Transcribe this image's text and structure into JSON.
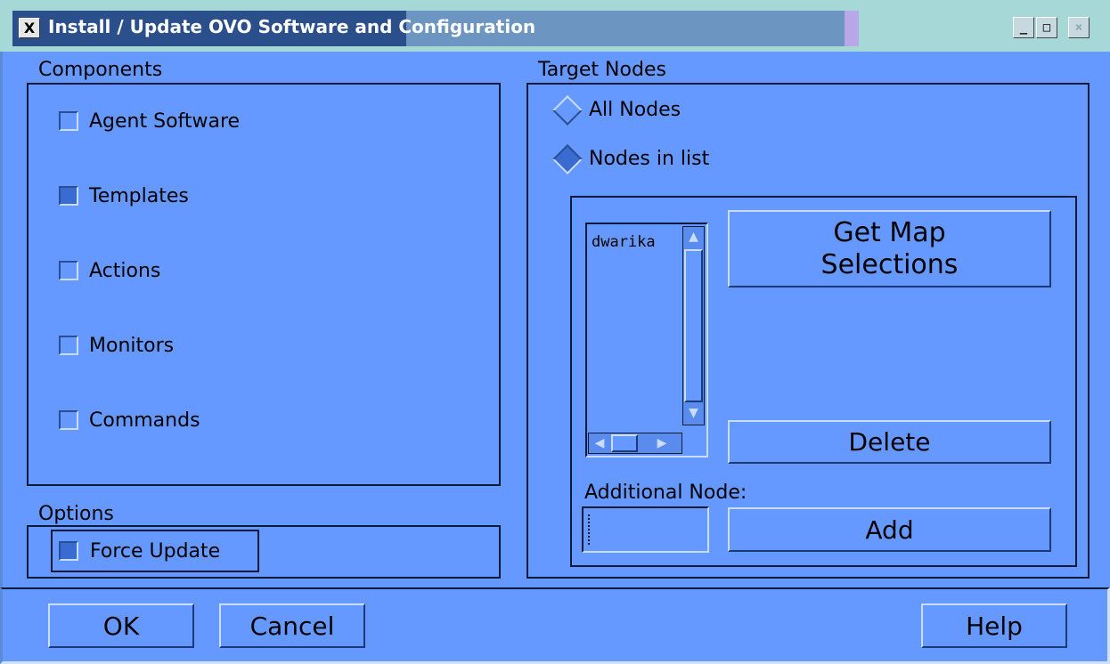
{
  "window": {
    "title": "Install / Update OVO Software and Configuration",
    "icon": "x-window-icon",
    "controls": {
      "minimize": "_",
      "maximize": "□",
      "close": "×"
    }
  },
  "components": {
    "label": "Components",
    "items": [
      {
        "label": "Agent Software",
        "checked": false
      },
      {
        "label": "Templates",
        "checked": true
      },
      {
        "label": "Actions",
        "checked": false
      },
      {
        "label": "Monitors",
        "checked": false
      },
      {
        "label": "Commands",
        "checked": false
      }
    ]
  },
  "options": {
    "label": "Options",
    "force_update": {
      "label": "Force Update",
      "checked": true
    }
  },
  "target_nodes": {
    "label": "Target Nodes",
    "all_nodes": {
      "label": "All Nodes",
      "selected": false
    },
    "nodes_in_list": {
      "label": "Nodes in list",
      "selected": true
    },
    "node_list": [
      "dwarika"
    ],
    "get_map_selections_line1": "Get Map",
    "get_map_selections_line2": "Selections",
    "delete_label": "Delete",
    "additional_node_label": "Additional Node:",
    "additional_node_value": "",
    "add_label": "Add"
  },
  "footer": {
    "ok_label": "OK",
    "cancel_label": "Cancel",
    "help_label": "Help"
  },
  "colors": {
    "background": "#6699ff",
    "titlebar_active": "#2a4f8a",
    "border_dark": "#0a1a3a"
  }
}
